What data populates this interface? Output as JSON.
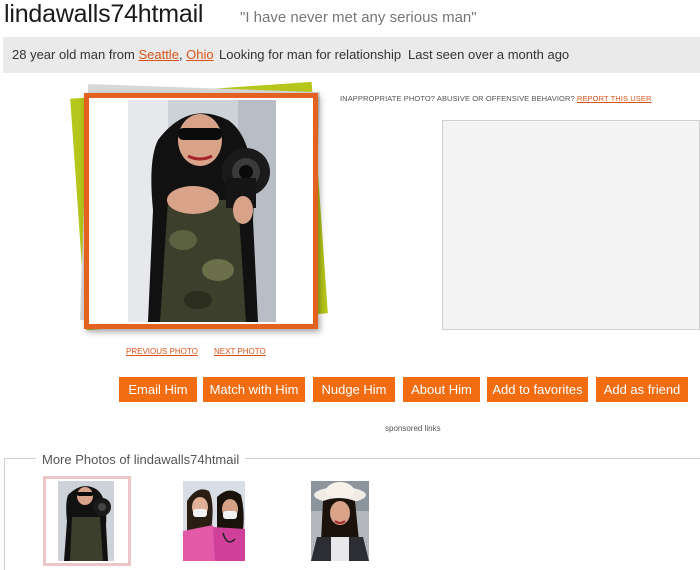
{
  "profile": {
    "username": "lindawalls74htmail",
    "tagline": "\"I have never met any serious man\""
  },
  "info": {
    "age_text": "28 year old man from ",
    "city": "Seattle",
    "separator": ", ",
    "state": "Ohio",
    "looking_for": "Looking for man for relationship",
    "last_seen": "Last seen over a month ago"
  },
  "report": {
    "text": "INAPPROPRIATE PHOTO? ABUSIVE OR OFFENSIVE BEHAVIOR? ",
    "link": "REPORT THIS USER"
  },
  "photo_nav": {
    "previous": "PREVIOUS PHOTO",
    "next": "NEXT PHOTO"
  },
  "actions": {
    "email": "Email Him",
    "match": "Match with Him",
    "nudge": "Nudge Him",
    "about": "About Him",
    "favorites": "Add to favorites",
    "friend": "Add as friend"
  },
  "sponsored": "sponsored links",
  "more_photos": {
    "title": "More Photos of lindawalls74htmail"
  },
  "colors": {
    "accent": "#f26c12",
    "link": "#d9541a",
    "frame_orange": "#e3621f",
    "frame_green": "#b6c61a",
    "infobar_bg": "#eaeaea"
  }
}
